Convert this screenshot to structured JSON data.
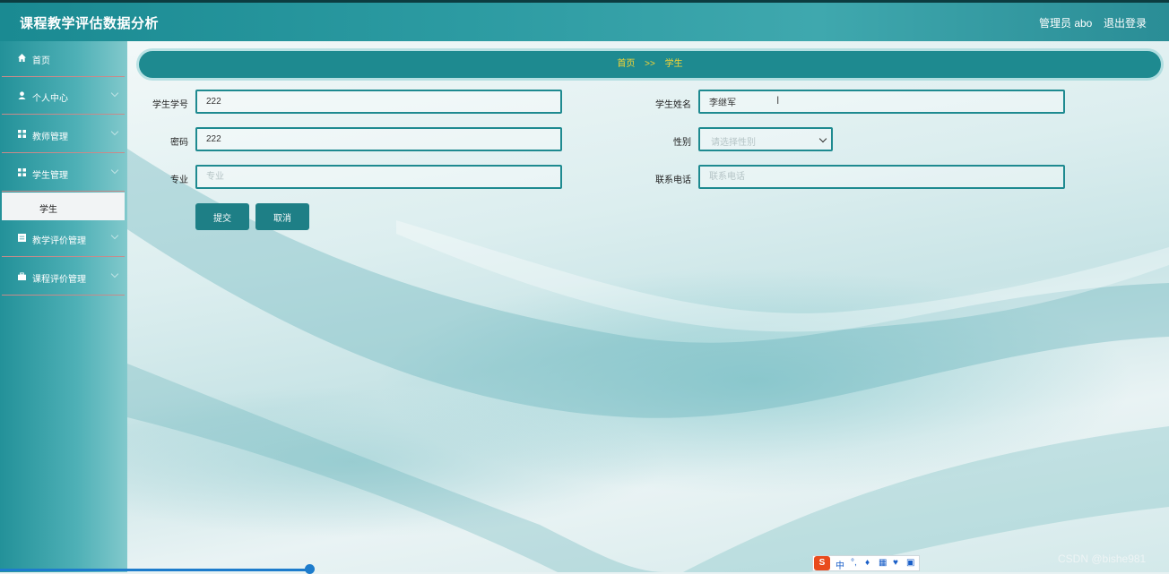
{
  "header": {
    "title": "课程教学评估数据分析",
    "user": "管理员 abo",
    "logout": "退出登录"
  },
  "sidebar": {
    "items": [
      {
        "label": "首页",
        "icon": "home-icon"
      },
      {
        "label": "个人中心",
        "icon": "user-icon"
      },
      {
        "label": "教师管理",
        "icon": "grid-icon"
      },
      {
        "label": "学生管理",
        "icon": "grid-icon"
      },
      {
        "label": "教学评价管理",
        "icon": "list-icon"
      },
      {
        "label": "课程评价管理",
        "icon": "briefcase-icon"
      }
    ],
    "subitem": "学生"
  },
  "breadcrumb": {
    "home": "首页",
    "separator": ">>",
    "current": "学生"
  },
  "form": {
    "student_id": {
      "label": "学生学号",
      "value": "222"
    },
    "student_name": {
      "label": "学生姓名",
      "value": "李继军"
    },
    "password": {
      "label": "密码",
      "value": "222"
    },
    "gender": {
      "label": "性别",
      "placeholder": "请选择性别"
    },
    "major": {
      "label": "专业",
      "placeholder": "专业"
    },
    "phone": {
      "label": "联系电话",
      "placeholder": "联系电话"
    },
    "submit": "提交",
    "cancel": "取消"
  },
  "ime": {
    "label": "中"
  },
  "watermark": "CSDN @bishe981",
  "colors": {
    "primary": "#1e8a90",
    "breadcrumb_text": "#f7d633"
  }
}
